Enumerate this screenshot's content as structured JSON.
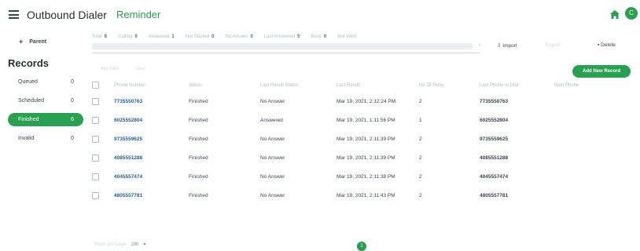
{
  "header": {
    "app_title": "Outbound Dialer",
    "subtitle": "Reminder",
    "avatar_initial": "C",
    "accent_color": "#27a04f"
  },
  "sidebar": {
    "parent_label": "Parent",
    "records_title": "Records",
    "items": [
      {
        "label": "Queued",
        "count": "0"
      },
      {
        "label": "Scheduled",
        "count": "0"
      },
      {
        "label": "Finished",
        "count": "6"
      },
      {
        "label": "Invalid",
        "count": "0"
      }
    ]
  },
  "filters": [
    {
      "label": "Total",
      "value": "6"
    },
    {
      "label": "Calling",
      "value": "0"
    },
    {
      "label": "Answered",
      "value": "1"
    },
    {
      "label": "Not Started",
      "value": "0"
    },
    {
      "label": "No Answer",
      "value": "0"
    },
    {
      "label": "Last Answered",
      "value": "5"
    },
    {
      "label": "Busy",
      "value": "0"
    },
    {
      "label": "Not Valid",
      "value": ""
    }
  ],
  "actions": {
    "import": "Import",
    "export": "Export",
    "delete": "Delete",
    "add_new_record": "Add New Record"
  },
  "search_hints": [
    "Add Filter",
    "Clear"
  ],
  "table": {
    "columns": [
      "Phone Number",
      "Status",
      "Last Result Status",
      "Last Result",
      "No Of Retry",
      "Last Phone to Dial",
      "Next Phone"
    ],
    "rows": [
      {
        "phone": "7735550763",
        "status": "Finished",
        "result_status": "No Answer",
        "last_result": "Mar 19, 2021, 2:12:24 PM",
        "retries": "2",
        "last_dial": "7735550763",
        "next": ""
      },
      {
        "phone": "6025552804",
        "status": "Finished",
        "result_status": "Answered",
        "last_result": "Mar 19, 2021, 1:11:56 PM",
        "retries": "1",
        "last_dial": "6025552804",
        "next": ""
      },
      {
        "phone": "9735559625",
        "status": "Finished",
        "result_status": "No Answer",
        "last_result": "Mar 19, 2021, 2:11:39 PM",
        "retries": "2",
        "last_dial": "9735559625",
        "next": ""
      },
      {
        "phone": "4085551288",
        "status": "Finished",
        "result_status": "No Answer",
        "last_result": "Mar 19, 2021, 2:11:39 PM",
        "retries": "2",
        "last_dial": "4085551288",
        "next": ""
      },
      {
        "phone": "4045557474",
        "status": "Finished",
        "result_status": "No Answer",
        "last_result": "Mar 19, 2021, 2:11:38 PM",
        "retries": "2",
        "last_dial": "4045557474",
        "next": ""
      },
      {
        "phone": "4805557781",
        "status": "Finished",
        "result_status": "No Answer",
        "last_result": "Mar 19, 2021, 2:11:43 PM",
        "retries": "2",
        "last_dial": "4805557781",
        "next": ""
      }
    ]
  },
  "footer": {
    "rows_per_page_label": "Rows per page",
    "rows_per_page_value": "100",
    "current_page": "1"
  }
}
